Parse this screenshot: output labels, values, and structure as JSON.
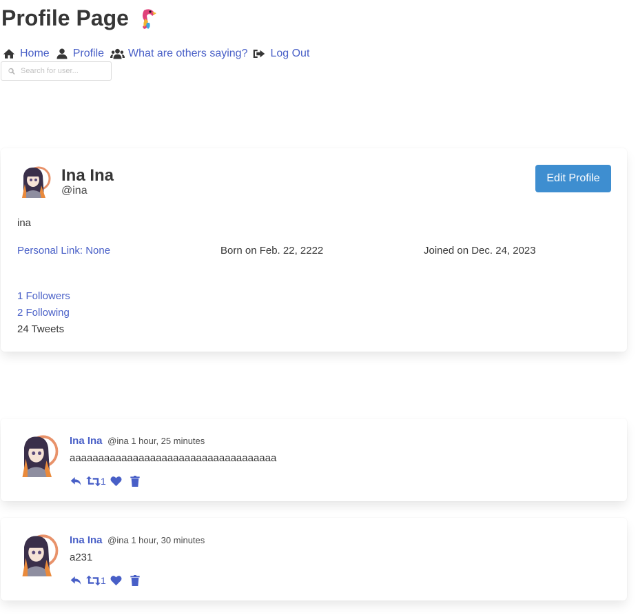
{
  "page": {
    "title": "Profile Page"
  },
  "nav": {
    "home": "Home",
    "profile": "Profile",
    "others": "What are others saying?",
    "logout": "Log Out"
  },
  "search": {
    "placeholder": "Search for user..."
  },
  "profile": {
    "name": "Ina Ina",
    "handle": "@ina",
    "edit_label": "Edit Profile",
    "bio": "ina",
    "personal_link": "Personal Link: None",
    "born": "Born on Feb. 22, 2222",
    "joined": "Joined on Dec. 24, 2023",
    "followers": "1 Followers",
    "following": "2 Following",
    "tweets": "24 Tweets"
  },
  "tweets": [
    {
      "name": "Ina Ina",
      "handle": "@ina",
      "time": "1 hour, 25 minutes",
      "text": "aaaaaaaaaaaaaaaaaaaaaaaaaaaaaaaaaaaa",
      "retweets": "1"
    },
    {
      "name": "Ina Ina",
      "handle": "@ina",
      "time": "1 hour, 30 minutes",
      "text": "a231",
      "retweets": "1"
    }
  ],
  "colors": {
    "link": "#485fc7",
    "button": "#3e8ed0",
    "text": "#363636"
  },
  "icons": [
    "parrot-icon",
    "home-icon",
    "user-icon",
    "users-icon",
    "logout-icon",
    "search-icon",
    "reply-icon",
    "retweet-icon",
    "heart-icon",
    "trash-icon"
  ]
}
